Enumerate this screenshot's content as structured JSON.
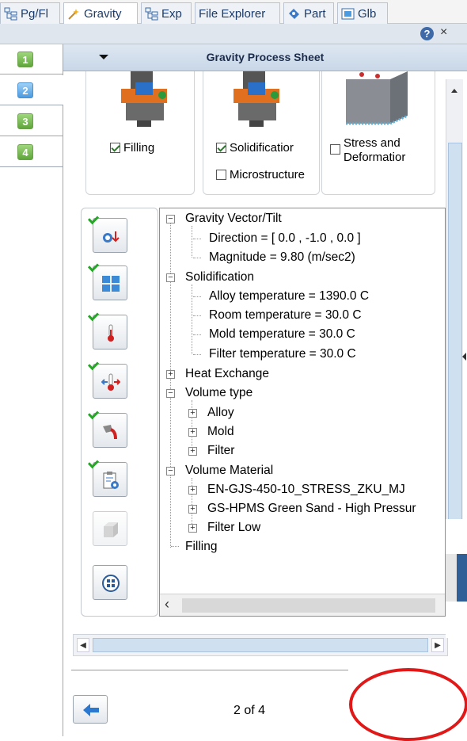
{
  "tabs": [
    {
      "label": "Pg/Fl",
      "icon": "tree-grid-icon"
    },
    {
      "label": "Gravity",
      "icon": "gravity-wand-icon"
    },
    {
      "label": "Exp",
      "icon": "tree-grid-icon"
    },
    {
      "label": "File Explorer",
      "icon": ""
    },
    {
      "label": "Part",
      "icon": "part-icon"
    },
    {
      "label": "Glb",
      "icon": "globe-window-icon"
    }
  ],
  "window": {
    "close_label": "×",
    "help_label": "?"
  },
  "steps": [
    "1",
    "2",
    "3",
    "4"
  ],
  "sheet": {
    "title": "Gravity Process Sheet"
  },
  "modules": {
    "filling": {
      "label": "Filling",
      "checked": true
    },
    "solidification": {
      "label": "Solidificatior",
      "checked": true
    },
    "microstructure": {
      "label": "Microstructure",
      "checked": false
    },
    "stress": {
      "label_line1": "Stress and",
      "label_line2": "Deformatior",
      "checked": false
    }
  },
  "tree": {
    "gravity": {
      "label": "Gravity Vector/Tilt",
      "direction": "Direction = [ 0.0 , -1.0 , 0.0 ]",
      "magnitude": "Magnitude = 9.80 (m/sec2)"
    },
    "solidification": {
      "label": "Solidification",
      "alloy": "Alloy temperature = 1390.0 C",
      "room": "Room temperature = 30.0 C",
      "mold": "Mold temperature = 30.0 C",
      "filter": "Filter temperature = 30.0 C"
    },
    "heat_exchange": "Heat Exchange",
    "volume_type": {
      "label": "Volume type",
      "alloy": "Alloy",
      "mold": "Mold",
      "filter": "Filter"
    },
    "volume_material": {
      "label": "Volume Material",
      "m1": "EN-GJS-450-10_STRESS_ZKU_MJ",
      "m2": "GS-HPMS Green Sand - High Pressur",
      "m3": "Filter Low"
    },
    "filling": "Filling",
    "expand_minus": "−",
    "expand_plus": "+"
  },
  "pager": {
    "text": "2 of 4"
  },
  "colors": {
    "accent": "#3f6aa8",
    "highlight": "#e01818",
    "check": "#26a626"
  }
}
